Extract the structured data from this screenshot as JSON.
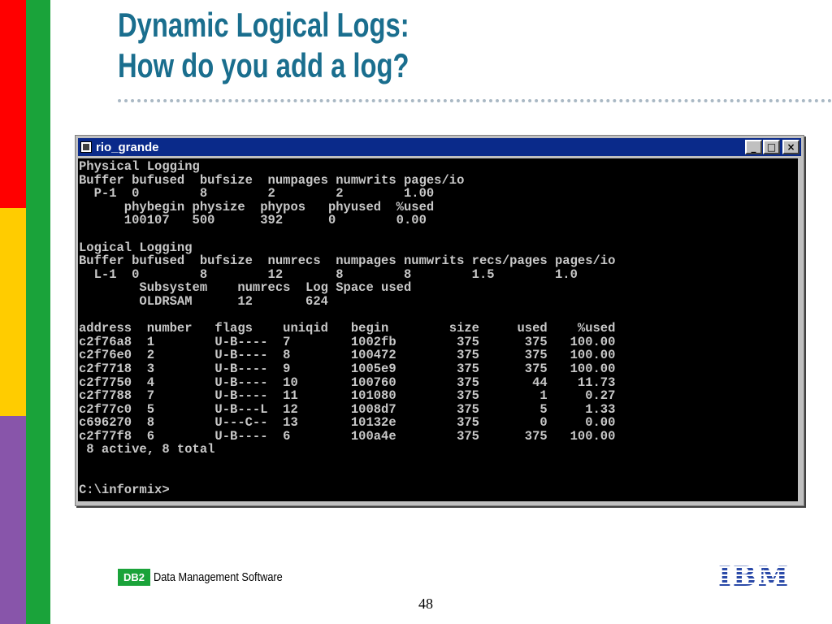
{
  "slide": {
    "title_line1": "Dynamic Logical Logs:",
    "title_line2": "How do you add a log?",
    "page_number": "48"
  },
  "window": {
    "title": "rio_grande",
    "buttons": [
      "_",
      "□",
      "×"
    ]
  },
  "console": {
    "lines": [
      "Physical Logging",
      "Buffer bufused  bufsize  numpages numwrits pages/io",
      "  P-1  0        8        2        2        1.00",
      "      phybegin physize  phypos   phyused  %used",
      "      100107   500      392      0        0.00",
      "",
      "Logical Logging",
      "Buffer bufused  bufsize  numrecs  numpages numwrits recs/pages pages/io",
      "  L-1  0        8        12       8        8        1.5        1.0",
      "        Subsystem    numrecs  Log Space used",
      "        OLDRSAM      12       624",
      "",
      "address  number   flags    uniqid   begin        size     used    %used",
      "c2f76a8  1        U-B----  7        1002fb        375      375   100.00",
      "c2f76e0  2        U-B----  8        100472        375      375   100.00",
      "c2f7718  3        U-B----  9        1005e9        375      375   100.00",
      "c2f7750  4        U-B----  10       100760        375       44    11.73",
      "c2f7788  7        U-B----  11       101080        375        1     0.27",
      "c2f77c0  5        U-B---L  12       1008d7        375        5     1.33",
      "c696270  8        U---C--  13       10132e        375        0     0.00",
      "c2f77f8  6        U-B----  6        100a4e        375      375   100.00",
      " 8 active, 8 total",
      "",
      "",
      "C:\\informix>"
    ]
  },
  "footer": {
    "badge": "DB2",
    "product": "Data Management Software",
    "logo": "IBM"
  },
  "colors": {
    "title": "#1a6e8e",
    "bar_red": "#ff0000",
    "bar_yellow": "#ffcc00",
    "bar_purple": "#8855aa",
    "bar_green": "#1aa33a",
    "titlebar": "#0a2a8a",
    "console_bg": "#000000",
    "console_text": "#c8c8c8"
  }
}
